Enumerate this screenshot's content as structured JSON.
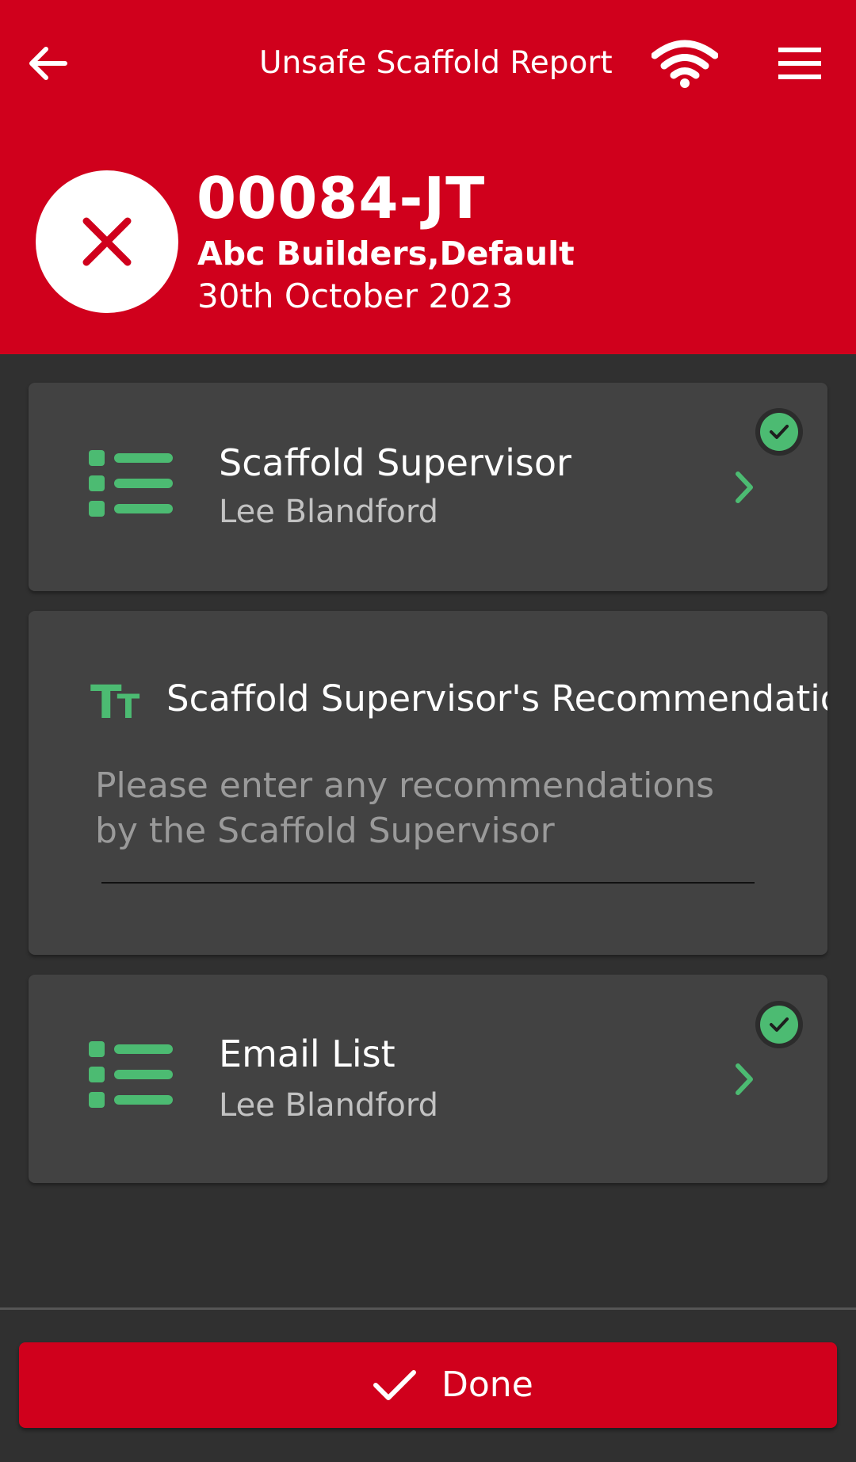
{
  "header": {
    "title": "Unsafe Scaffold Report",
    "back_icon": "arrow-left-icon",
    "wifi_icon": "wifi-icon",
    "menu_icon": "hamburger-menu-icon",
    "background_color": "#d0001c"
  },
  "report": {
    "status_icon": "close-x-icon",
    "status_color": "#d0001c",
    "reference": "00084-JT",
    "company": "Abc Builders,Default",
    "date": "30th October 2023"
  },
  "cards": [
    {
      "icon": "list-icon",
      "title": "Scaffold Supervisor",
      "subtitle": "Lee Blandford",
      "completed": true
    },
    {
      "icon": "text-format-icon",
      "title": "Scaffold Supervisor's Recommendations",
      "placeholder": "Please enter any recommendations by the Scaffold Supervisor",
      "value": ""
    },
    {
      "icon": "list-icon",
      "title": "Email List",
      "subtitle": "Lee Blandford",
      "completed": true
    }
  ],
  "footer": {
    "done_label": "Done",
    "done_icon": "checkmark-icon"
  },
  "colors": {
    "accent_green": "#4cbb72",
    "card_background": "#424242",
    "page_background": "#303030"
  }
}
